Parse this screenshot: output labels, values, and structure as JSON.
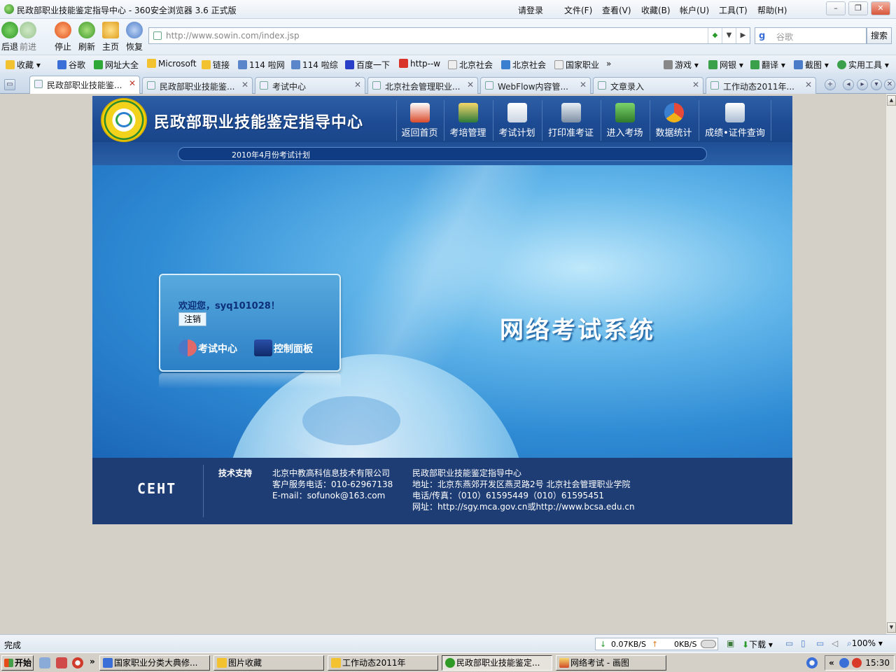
{
  "window": {
    "title": "民政部职业技能鉴定指导中心 - 360安全浏览器 3.6 正式版",
    "menu": [
      "请登录",
      "文件(F)",
      "查看(V)",
      "收藏(B)",
      "帐户(U)",
      "工具(T)",
      "帮助(H)"
    ]
  },
  "nav": {
    "back": "后退",
    "forward": "前进",
    "stop": "停止",
    "refresh": "刷新",
    "home": "主页",
    "restore": "恢复",
    "address": "http://www.sowin.com/index.jsp",
    "search_placeholder": "谷歌",
    "search_button": "搜索"
  },
  "favorites": [
    "收藏",
    "谷歌",
    "网址大全",
    "Microsoft",
    "链接",
    "114 啦网",
    "114 啦综",
    "百度一下",
    "http--w",
    "北京社会",
    "北京社会",
    "国家职业",
    "»"
  ],
  "favorites_right": [
    "游戏",
    "网银",
    "翻译",
    "截图",
    "实用工具"
  ],
  "tabs": [
    "民政部职业技能鉴...",
    "民政部职业技能鉴...",
    "考试中心",
    "北京社会管理职业...",
    "WebFlow内容管...",
    "文章录入",
    "工作动态2011年..."
  ],
  "site": {
    "title": "民政部职业技能鉴定指导中心",
    "nav": [
      "返回首页",
      "考培管理",
      "考试计划",
      "打印准考证",
      "进入考场",
      "数据统计",
      "成绩•证件查询"
    ],
    "marquee": "2010年4月份考试计划",
    "welcome": "欢迎您，syq101028！",
    "logout": "注销",
    "exam_center": "考试中心",
    "control_panel": "控制面板",
    "system_title": "网络考试系统"
  },
  "footer": {
    "logo": "CEHT",
    "support_label": "技术支持",
    "company": "北京中教高科信息技术有限公司",
    "service_phone": "客户服务电话：010-62967138",
    "email": "E-mail：sofunok@163.com",
    "org": "民政部职业技能鉴定指导中心",
    "address": "地址：北京东燕郊开发区燕灵路2号 北京社会管理职业学院",
    "phone_fax": "电话/传真：（010）61595449（010）61595451",
    "website": "网址：http://sgy.mca.gov.cn或http://www.bcsa.edu.cn"
  },
  "status": {
    "text": "完成",
    "download_speed": "0.07KB/S",
    "upload_speed": "0KB/S",
    "download": "下载",
    "zoom": "100%"
  },
  "taskbar": {
    "start": "开始",
    "tasks": [
      "国家职业分类大典修...",
      "图片收藏",
      "工作动态2011年",
      "民政部职业技能鉴定...",
      "网络考试 - 画图"
    ],
    "clock": "15:30"
  },
  "colors": {
    "banner": "#1d4b93",
    "footer": "#1e3d75",
    "welcome_text": "#0d2f79"
  }
}
